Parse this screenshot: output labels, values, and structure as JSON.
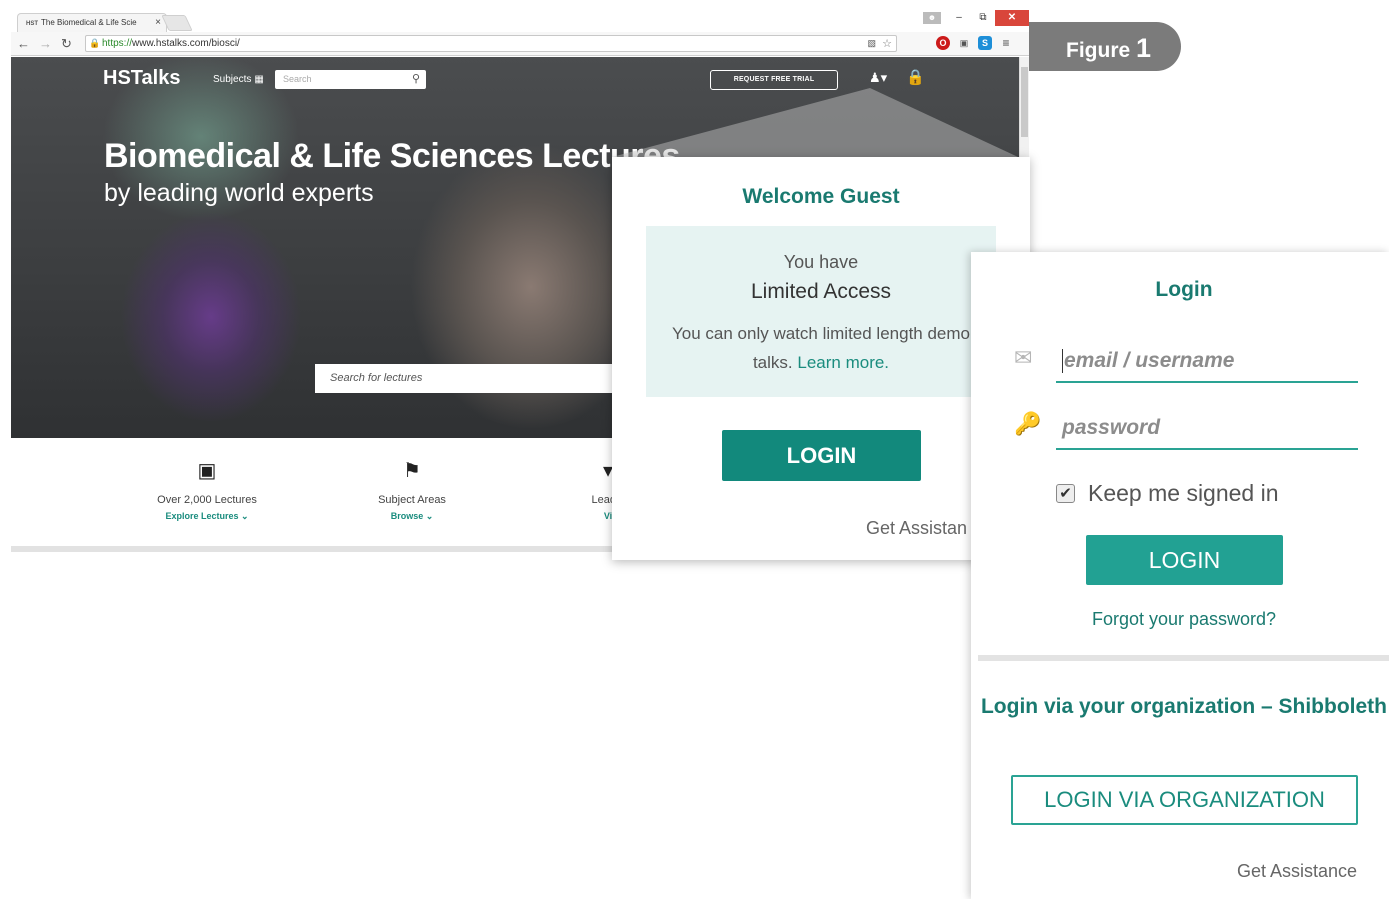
{
  "browser": {
    "tab_title": "The Biomedical & Life Scie",
    "tab_favicon": "HST",
    "url_scheme": "https://",
    "url_rest": "www.hstalks.com/biosci/"
  },
  "site": {
    "logo": "HSTalks",
    "subjects_label": "Subjects",
    "search_placeholder": "Search",
    "trial_button": "REQUEST FREE TRIAL",
    "hero_title": "Biomedical & Life Sciences Lectures",
    "hero_subtitle": "by leading world experts",
    "lecture_search_placeholder": "Search for lectures",
    "features": [
      {
        "label": "Over 2,000 Lectures",
        "link": "Explore Lectures"
      },
      {
        "label": "Subject Areas",
        "link": "Browse"
      },
      {
        "label": "Leadin",
        "link": "Vi"
      }
    ]
  },
  "figure": {
    "label": "Figure",
    "number": "1"
  },
  "welcome": {
    "title": "Welcome Guest",
    "line1": "You have",
    "line2": "Limited Access",
    "line3": "You can only watch limited length demo talks.",
    "learn_more": "Learn more.",
    "login_button": "LOGIN",
    "assistance": "Get Assistan"
  },
  "login": {
    "title": "Login",
    "email_placeholder": "email / username",
    "password_placeholder": "password",
    "keep_signed_in": "Keep me signed in",
    "keep_checked": true,
    "login_button": "LOGIN",
    "forgot": "Forgot your password?",
    "org_title": "Login via your organization – Shibboleth",
    "org_button": "LOGIN VIA ORGANIZATION",
    "assistance": "Get Assistance"
  },
  "colors": {
    "accent": "#12897c",
    "accent_light": "#2aa394",
    "panel_tint": "#e6f3f2",
    "figure_badge": "#7b7b7b"
  }
}
